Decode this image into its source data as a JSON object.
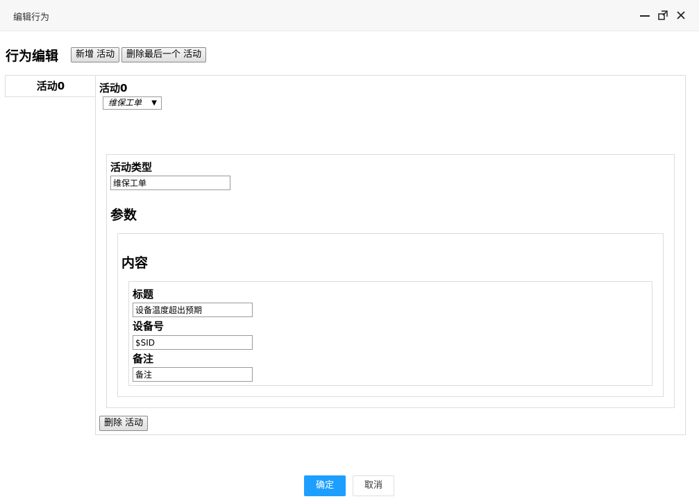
{
  "window": {
    "title": "编辑行为",
    "controls": {
      "minimize_icon": "minimize-icon",
      "maximize_icon": "maximize-icon",
      "close_icon": "close-icon"
    }
  },
  "editor": {
    "heading": "行为编辑",
    "add_button": "新增 活动",
    "remove_last_button": "删除最后一个 活动"
  },
  "tabs": [
    {
      "label": "活动0",
      "active": true
    }
  ],
  "activity": {
    "title": "活动0",
    "selected_type": "维保工单",
    "type_section": {
      "label": "活动类型",
      "value": "维保工单"
    },
    "params_label": "参数",
    "content": {
      "label": "内容",
      "fields": [
        {
          "label": "标题",
          "value": "设备温度超出预期"
        },
        {
          "label": "设备号",
          "value": "$SID"
        },
        {
          "label": "备注",
          "value": "备注"
        }
      ]
    },
    "delete_button": "删除 活动"
  },
  "footer": {
    "ok_label": "确定",
    "cancel_label": "取消"
  },
  "colors": {
    "primary": "#1e9fff",
    "border": "#dcdcdc",
    "titlebar": "#f7f7f7"
  }
}
